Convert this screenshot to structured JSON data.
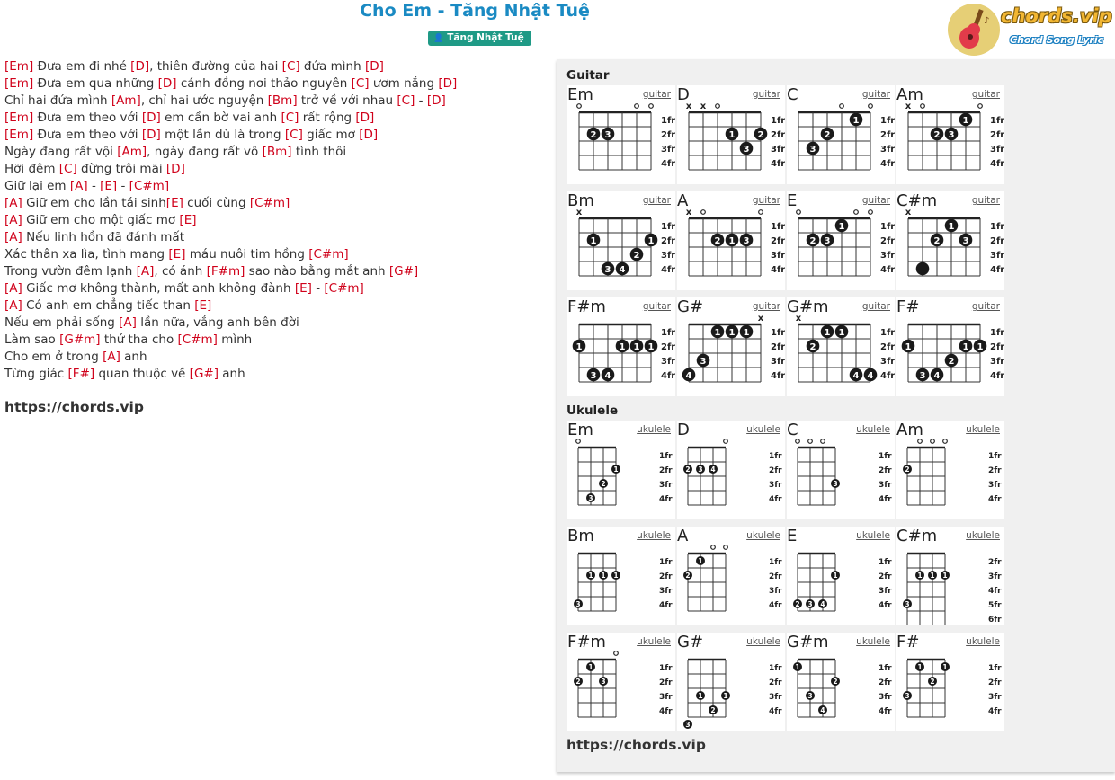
{
  "header": {
    "title": "Cho Em - Tăng Nhật Tuệ",
    "artist": "Tăng Nhật Tuệ",
    "artist_icon": "user-icon"
  },
  "logo": {
    "text": "chords.vip",
    "subtitle": "Chord Song Lyric"
  },
  "lyrics": [
    [
      [
        "c",
        "Em"
      ],
      [
        "t",
        " Đưa em đi nhé "
      ],
      [
        "c",
        "D"
      ],
      [
        "t",
        ", thiên đường của hai "
      ],
      [
        "c",
        "C"
      ],
      [
        "t",
        " đứa mình "
      ],
      [
        "c",
        "D"
      ]
    ],
    [
      [
        "c",
        "Em"
      ],
      [
        "t",
        " Đưa em qua những "
      ],
      [
        "c",
        "D"
      ],
      [
        "t",
        " cánh đồng nơi thảo nguyên "
      ],
      [
        "c",
        "C"
      ],
      [
        "t",
        " ươm nắng "
      ],
      [
        "c",
        "D"
      ]
    ],
    [
      [
        "t",
        "Chỉ hai đứa mình "
      ],
      [
        "c",
        "Am"
      ],
      [
        "t",
        ", chỉ hai ước nguyện "
      ],
      [
        "c",
        "Bm"
      ],
      [
        "t",
        " trở về với nhau "
      ],
      [
        "c",
        "C"
      ],
      [
        "t",
        " - "
      ],
      [
        "c",
        "D"
      ]
    ],
    [
      [
        "c",
        "Em"
      ],
      [
        "t",
        " Đưa em theo với "
      ],
      [
        "c",
        "D"
      ],
      [
        "t",
        " em cần bờ vai anh "
      ],
      [
        "c",
        "C"
      ],
      [
        "t",
        " rất rộng "
      ],
      [
        "c",
        "D"
      ]
    ],
    [
      [
        "c",
        "Em"
      ],
      [
        "t",
        " Đưa em theo với "
      ],
      [
        "c",
        "D"
      ],
      [
        "t",
        " một lần dù là trong "
      ],
      [
        "c",
        "C"
      ],
      [
        "t",
        " giấc mơ "
      ],
      [
        "c",
        "D"
      ]
    ],
    [
      [
        "t",
        "Ngày đang rất vội "
      ],
      [
        "c",
        "Am"
      ],
      [
        "t",
        ", ngày đang rất vô "
      ],
      [
        "c",
        "Bm"
      ],
      [
        "t",
        " tình thôi"
      ]
    ],
    [
      [
        "t",
        "Hỡi đêm "
      ],
      [
        "c",
        "C"
      ],
      [
        "t",
        " đừng trôi mãi "
      ],
      [
        "c",
        "D"
      ]
    ],
    [
      [
        "t",
        "Giữ lại em "
      ],
      [
        "c",
        "A"
      ],
      [
        "t",
        " - "
      ],
      [
        "c",
        "E"
      ],
      [
        "t",
        " - "
      ],
      [
        "c",
        "C#m"
      ]
    ],
    [
      [
        "c",
        "A"
      ],
      [
        "t",
        " Giữ em cho lần tái sinh"
      ],
      [
        "c",
        "E"
      ],
      [
        "t",
        " cuối cùng "
      ],
      [
        "c",
        "C#m"
      ]
    ],
    [
      [
        "c",
        "A"
      ],
      [
        "t",
        " Giữ em cho một giấc mơ "
      ],
      [
        "c",
        "E"
      ]
    ],
    [
      [
        "c",
        "A"
      ],
      [
        "t",
        " Nếu linh hồn đã đánh mất"
      ]
    ],
    [
      [
        "t",
        "Xác thân xa lìa, tình mang "
      ],
      [
        "c",
        "E"
      ],
      [
        "t",
        " máu nuôi tim hồng "
      ],
      [
        "c",
        "C#m"
      ]
    ],
    [
      [
        "t",
        "Trong vườn đêm lạnh "
      ],
      [
        "c",
        "A"
      ],
      [
        "t",
        ", có ánh "
      ],
      [
        "c",
        "F#m"
      ],
      [
        "t",
        " sao nào bằng mắt anh "
      ],
      [
        "c",
        "G#"
      ]
    ],
    [
      [
        "c",
        "A"
      ],
      [
        "t",
        " Giấc mơ không thành, mất anh không đành "
      ],
      [
        "c",
        "E"
      ],
      [
        "t",
        " - "
      ],
      [
        "c",
        "C#m"
      ]
    ],
    [
      [
        "c",
        "A"
      ],
      [
        "t",
        " Có anh em chẳng tiếc than "
      ],
      [
        "c",
        "E"
      ]
    ],
    [
      [
        "t",
        "Nếu em phải sống "
      ],
      [
        "c",
        "A"
      ],
      [
        "t",
        " lần nữa, vắng anh bên đời"
      ]
    ],
    [
      [
        "t",
        "Làm sao "
      ],
      [
        "c",
        "G#m"
      ],
      [
        "t",
        " thứ tha cho "
      ],
      [
        "c",
        "C#m"
      ],
      [
        "t",
        " mình"
      ]
    ],
    [
      [
        "t",
        "Cho em ở trong "
      ],
      [
        "c",
        "A"
      ],
      [
        "t",
        " anh"
      ]
    ],
    [
      [
        "t",
        "Từng giác "
      ],
      [
        "c",
        "F#"
      ],
      [
        "t",
        " quan thuộc về "
      ],
      [
        "c",
        "G#"
      ],
      [
        "t",
        " anh"
      ]
    ]
  ],
  "footer_url": "https://chords.vip",
  "guitar": {
    "title": "Guitar",
    "link_label": "guitar",
    "fret_labels": [
      "1fr",
      "2fr",
      "3fr",
      "4fr"
    ],
    "chords": [
      {
        "name": "Em",
        "markers": "o   oo",
        "dots": [
          [
            1,
            2,
            "2"
          ],
          [
            2,
            2,
            "3"
          ]
        ]
      },
      {
        "name": "D",
        "markers": "xxo   ",
        "dots": [
          [
            3,
            2,
            "1"
          ],
          [
            4,
            3,
            "3"
          ],
          [
            5,
            2,
            "2"
          ]
        ]
      },
      {
        "name": "C",
        "markers": "   o o",
        "dots": [
          [
            1,
            3,
            "3"
          ],
          [
            2,
            2,
            "2"
          ],
          [
            4,
            1,
            "1"
          ]
        ]
      },
      {
        "name": "Am",
        "markers": "xo   o",
        "dots": [
          [
            2,
            2,
            "2"
          ],
          [
            3,
            2,
            "3"
          ],
          [
            4,
            1,
            "1"
          ]
        ]
      },
      {
        "name": "Bm",
        "markers": "x     ",
        "dots": [
          [
            1,
            2,
            "1"
          ],
          [
            2,
            4,
            "3"
          ],
          [
            3,
            4,
            "4"
          ],
          [
            4,
            3,
            "2"
          ],
          [
            5,
            2,
            "1"
          ]
        ]
      },
      {
        "name": "A",
        "markers": "xo   o",
        "dots": [
          [
            2,
            2,
            "2"
          ],
          [
            3,
            2,
            "1"
          ],
          [
            4,
            2,
            "3"
          ]
        ]
      },
      {
        "name": "E",
        "markers": "o   oo",
        "dots": [
          [
            1,
            2,
            "2"
          ],
          [
            2,
            2,
            "3"
          ],
          [
            3,
            1,
            "1"
          ]
        ]
      },
      {
        "name": "C#m",
        "markers": "x     ",
        "dots": [
          [
            1,
            4,
            ""
          ],
          [
            2,
            2,
            "2"
          ],
          [
            3,
            1,
            "1"
          ],
          [
            4,
            2,
            "3"
          ]
        ]
      },
      {
        "name": "F#m",
        "markers": "      ",
        "dots": [
          [
            0,
            2,
            "1"
          ],
          [
            1,
            4,
            "3"
          ],
          [
            2,
            4,
            "4"
          ],
          [
            3,
            2,
            "1"
          ],
          [
            4,
            2,
            "1"
          ],
          [
            5,
            2,
            "1"
          ]
        ]
      },
      {
        "name": "G#",
        "markers": "     x",
        "dots": [
          [
            0,
            4,
            "4"
          ],
          [
            1,
            3,
            "3"
          ],
          [
            2,
            1,
            "1"
          ],
          [
            3,
            1,
            "1"
          ],
          [
            4,
            1,
            "1"
          ]
        ]
      },
      {
        "name": "G#m",
        "markers": "x     ",
        "dots": [
          [
            1,
            2,
            "2"
          ],
          [
            2,
            1,
            "1"
          ],
          [
            3,
            1,
            "1"
          ],
          [
            4,
            4,
            "4"
          ],
          [
            5,
            4,
            "4"
          ]
        ]
      },
      {
        "name": "F#",
        "markers": "      ",
        "dots": [
          [
            0,
            2,
            "1"
          ],
          [
            1,
            4,
            "3"
          ],
          [
            2,
            4,
            "4"
          ],
          [
            3,
            3,
            "2"
          ],
          [
            4,
            2,
            "1"
          ],
          [
            5,
            2,
            "1"
          ]
        ]
      }
    ]
  },
  "ukulele": {
    "title": "Ukulele",
    "link_label": "ukulele",
    "chords": [
      {
        "name": "Em",
        "markers": "o   ",
        "frets": [
          "1fr",
          "2fr",
          "3fr",
          "4fr"
        ],
        "dots": [
          [
            1,
            4,
            "3"
          ],
          [
            2,
            3,
            "2"
          ],
          [
            3,
            2,
            "1"
          ]
        ]
      },
      {
        "name": "D",
        "markers": "   o",
        "frets": [
          "1fr",
          "2fr",
          "3fr",
          "4fr"
        ],
        "dots": [
          [
            0,
            2,
            "2"
          ],
          [
            1,
            2,
            "3"
          ],
          [
            2,
            2,
            "4"
          ]
        ]
      },
      {
        "name": "C",
        "markers": "ooo ",
        "frets": [
          "1fr",
          "2fr",
          "3fr",
          "4fr"
        ],
        "dots": [
          [
            3,
            3,
            "3"
          ]
        ]
      },
      {
        "name": "Am",
        "markers": " ooo",
        "frets": [
          "1fr",
          "2fr",
          "3fr",
          "4fr"
        ],
        "dots": [
          [
            0,
            2,
            "2"
          ]
        ]
      },
      {
        "name": "Bm",
        "markers": "    ",
        "frets": [
          "1fr",
          "2fr",
          "3fr",
          "4fr"
        ],
        "dots": [
          [
            0,
            4,
            "3"
          ],
          [
            1,
            2,
            "1"
          ],
          [
            2,
            2,
            "1"
          ],
          [
            3,
            2,
            "1"
          ]
        ]
      },
      {
        "name": "A",
        "markers": "  oo",
        "frets": [
          "1fr",
          "2fr",
          "3fr",
          "4fr"
        ],
        "dots": [
          [
            0,
            2,
            "2"
          ],
          [
            1,
            1,
            "1"
          ]
        ]
      },
      {
        "name": "E",
        "markers": "    ",
        "frets": [
          "1fr",
          "2fr",
          "3fr",
          "4fr"
        ],
        "dots": [
          [
            0,
            4,
            "2"
          ],
          [
            1,
            4,
            "3"
          ],
          [
            2,
            4,
            "4"
          ],
          [
            3,
            2,
            "1"
          ]
        ]
      },
      {
        "name": "C#m",
        "markers": "    ",
        "frets": [
          "2fr",
          "3fr",
          "4fr",
          "5fr",
          "6fr"
        ],
        "dots": [
          [
            0,
            4,
            "3"
          ],
          [
            1,
            2,
            "1"
          ],
          [
            2,
            2,
            "1"
          ],
          [
            3,
            2,
            "1"
          ]
        ]
      },
      {
        "name": "F#m",
        "markers": "   o",
        "frets": [
          "1fr",
          "2fr",
          "3fr",
          "4fr"
        ],
        "dots": [
          [
            0,
            2,
            "2"
          ],
          [
            1,
            1,
            "1"
          ],
          [
            2,
            2,
            "3"
          ]
        ]
      },
      {
        "name": "G#",
        "markers": "    ",
        "frets": [
          "1fr",
          "2fr",
          "3fr",
          "4fr"
        ],
        "dots": [
          [
            0,
            5,
            "3"
          ],
          [
            1,
            3,
            "1"
          ],
          [
            2,
            4,
            "2"
          ],
          [
            3,
            3,
            "1"
          ]
        ]
      },
      {
        "name": "G#m",
        "markers": "    ",
        "frets": [
          "1fr",
          "2fr",
          "3fr",
          "4fr"
        ],
        "dots": [
          [
            0,
            1,
            "1"
          ],
          [
            1,
            3,
            "3"
          ],
          [
            2,
            4,
            "4"
          ],
          [
            3,
            2,
            "2"
          ]
        ]
      },
      {
        "name": "F#",
        "markers": "    ",
        "frets": [
          "1fr",
          "2fr",
          "3fr",
          "4fr"
        ],
        "dots": [
          [
            0,
            3,
            "3"
          ],
          [
            1,
            1,
            "1"
          ],
          [
            2,
            2,
            "2"
          ],
          [
            3,
            1,
            "1"
          ]
        ]
      }
    ]
  }
}
